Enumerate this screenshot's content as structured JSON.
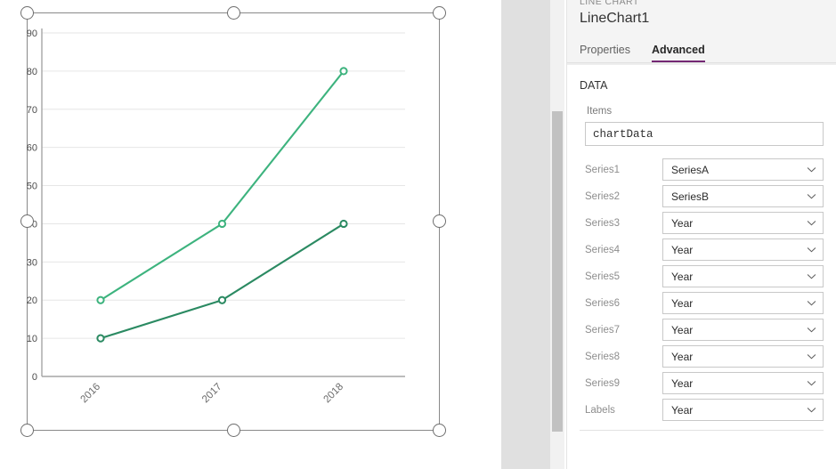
{
  "chart_data": {
    "type": "line",
    "title": "",
    "xlabel": "",
    "ylabel": "",
    "categories": [
      "2016",
      "2017",
      "2018"
    ],
    "x_tick_labels": [
      "2016",
      "2017",
      "2018"
    ],
    "y_tick_labels": [
      "0",
      "10",
      "20",
      "30",
      "40",
      "50",
      "60",
      "70",
      "80",
      "90"
    ],
    "y_tick_values": [
      0,
      10,
      20,
      30,
      40,
      50,
      60,
      70,
      80,
      90
    ],
    "ylim": [
      0,
      90
    ],
    "grid": true,
    "legend": "none",
    "series": [
      {
        "name": "SeriesA",
        "color": "#3db37e",
        "values": [
          20,
          40,
          80
        ]
      },
      {
        "name": "SeriesB",
        "color": "#2b8a62",
        "values": [
          10,
          20,
          40
        ]
      }
    ]
  },
  "canvas": {
    "selection_handles": [
      "top-left",
      "top-center",
      "top-right",
      "middle-left",
      "middle-right",
      "bottom-left",
      "bottom-center",
      "bottom-right"
    ],
    "selection_border_color": "#898989"
  },
  "panel": {
    "kicker": "LINE CHART",
    "title": "LineChart1",
    "tabs": [
      {
        "label": "Properties",
        "active": false
      },
      {
        "label": "Advanced",
        "active": true
      }
    ],
    "accent_color": "#742774",
    "section": {
      "title": "DATA",
      "items_label": "Items",
      "items_value": "chartData",
      "items_placeholder": "chartData"
    },
    "fields": [
      {
        "label": "Series1",
        "value": "SeriesA"
      },
      {
        "label": "Series2",
        "value": "SeriesB"
      },
      {
        "label": "Series3",
        "value": "Year"
      },
      {
        "label": "Series4",
        "value": "Year"
      },
      {
        "label": "Series5",
        "value": "Year"
      },
      {
        "label": "Series6",
        "value": "Year"
      },
      {
        "label": "Series7",
        "value": "Year"
      },
      {
        "label": "Series8",
        "value": "Year"
      },
      {
        "label": "Series9",
        "value": "Year"
      },
      {
        "label": "Labels",
        "value": "Year"
      }
    ],
    "dropdown_icon": "chevron-down-icon",
    "scrollbar": {
      "present": true
    }
  }
}
